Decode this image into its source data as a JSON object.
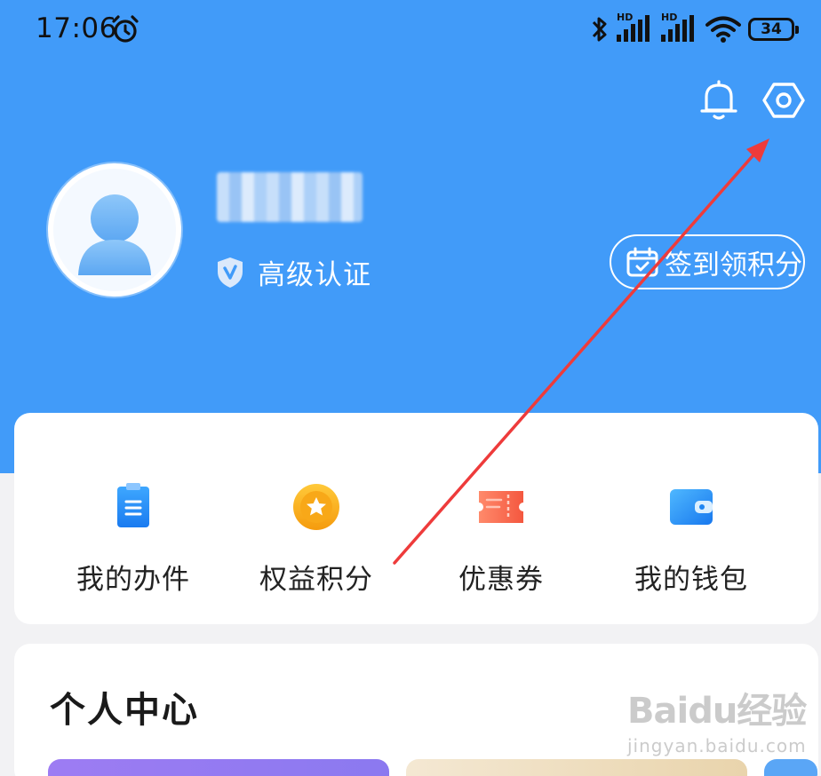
{
  "status_bar": {
    "time": "17:06",
    "hd_label_1": "HD",
    "hd_label_2": "HD",
    "battery": "34",
    "icons": [
      "alarm-icon",
      "bluetooth-icon",
      "signal-icon",
      "signal-icon",
      "wifi-icon",
      "battery-icon"
    ]
  },
  "header": {
    "icons": [
      "bell-icon",
      "gear-icon"
    ]
  },
  "profile": {
    "username": "",
    "verify_label": "高级认证",
    "checkin_label": "签到领积分"
  },
  "quick_actions": [
    {
      "label": "我的办件",
      "icon": "clipboard-icon"
    },
    {
      "label": "权益积分",
      "icon": "star-coin-icon"
    },
    {
      "label": "优惠券",
      "icon": "ticket-icon"
    },
    {
      "label": "我的钱包",
      "icon": "wallet-icon"
    }
  ],
  "personal_center": {
    "title": "个人中心"
  },
  "watermark": {
    "logo": "Baidu经验",
    "url": "jingyan.baidu.com"
  },
  "colors": {
    "header_bg": "#419bf9",
    "page_bg": "#f2f2f4",
    "annotation_arrow": "#ee3b3b"
  }
}
